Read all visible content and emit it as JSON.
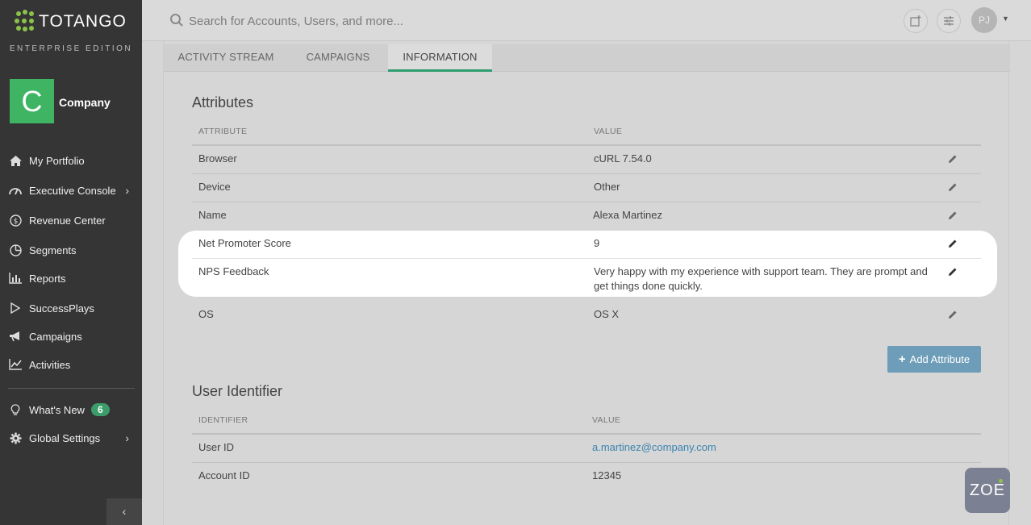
{
  "brand": {
    "name": "TOTANGO",
    "edition": "ENTERPRISE EDITION",
    "accent_color": "#2e9e6f",
    "logo_color": "#8bc34a"
  },
  "company": {
    "initial": "C",
    "name": "Company",
    "tile_color": "#3fb564"
  },
  "nav": {
    "items": [
      {
        "label": "My Portfolio",
        "icon": "home-icon"
      },
      {
        "label": "Executive Console",
        "icon": "gauge-icon"
      },
      {
        "label": "Revenue Center",
        "icon": "dollar-icon"
      },
      {
        "label": "Segments",
        "icon": "pie-icon"
      },
      {
        "label": "Reports",
        "icon": "bar-chart-icon"
      },
      {
        "label": "SuccessPlays",
        "icon": "play-icon"
      },
      {
        "label": "Campaigns",
        "icon": "megaphone-icon"
      },
      {
        "label": "Activities",
        "icon": "line-chart-icon"
      }
    ],
    "whats_new": {
      "label": "What's New",
      "badge": "6",
      "icon": "lightbulb-icon"
    },
    "global_settings": {
      "label": "Global Settings",
      "icon": "gear-icon"
    },
    "collapse_icon": "chevron-left-icon"
  },
  "search": {
    "placeholder": "Search for Accounts, Users, and more...",
    "value": ""
  },
  "user": {
    "initials": "PJ"
  },
  "tabs": [
    {
      "label": "ACTIVITY STREAM",
      "active": false
    },
    {
      "label": "CAMPAIGNS",
      "active": false
    },
    {
      "label": "INFORMATION",
      "active": true
    }
  ],
  "attributes": {
    "title": "Attributes",
    "col_attribute": "ATTRIBUTE",
    "col_value": "VALUE",
    "rows": [
      {
        "attribute": "Browser",
        "value": "cURL 7.54.0"
      },
      {
        "attribute": "Device",
        "value": "Other"
      },
      {
        "attribute": "Name",
        "value": "Alexa Martinez"
      },
      {
        "attribute": "Net Promoter Score",
        "value": "9"
      },
      {
        "attribute": "NPS Feedback",
        "value_line1": "Very happy with my experience with support team. They are prompt and",
        "value_line2": "get things done quickly."
      },
      {
        "attribute": "OS",
        "value": "OS X"
      }
    ],
    "add_button": "Add Attribute"
  },
  "identifiers": {
    "title": "User Identifier",
    "col_identifier": "IDENTIFIER",
    "col_value": "VALUE",
    "rows": [
      {
        "identifier": "User ID",
        "value": "a.martinez@company.com"
      },
      {
        "identifier": "Account ID",
        "value": "12345"
      }
    ]
  },
  "assistant": {
    "label": "ZOE"
  }
}
